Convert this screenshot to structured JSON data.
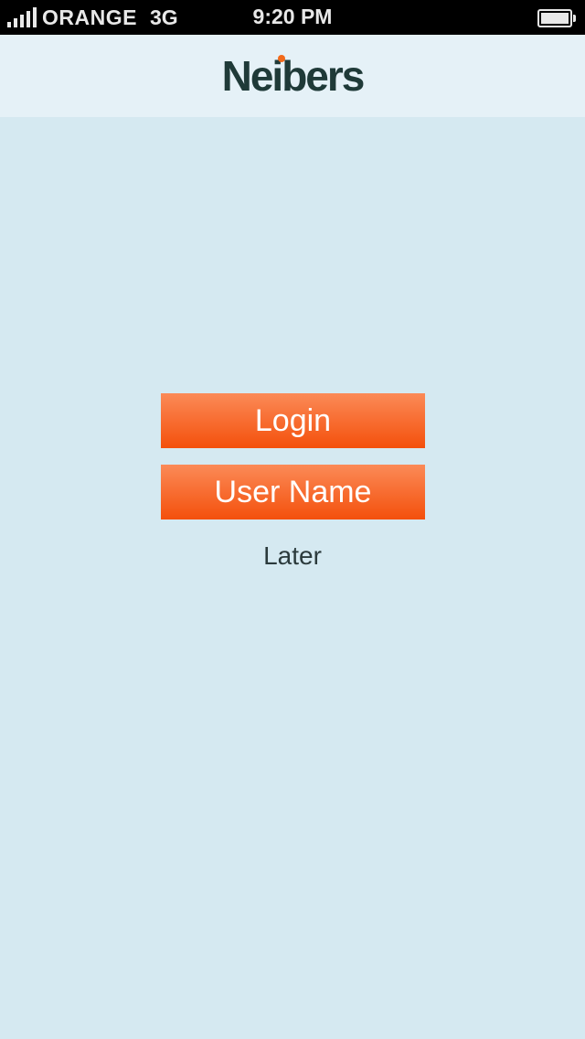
{
  "status_bar": {
    "carrier": "ORANGE",
    "network": "3G",
    "time": "9:20 PM",
    "signal_icon": "signal-bars-icon",
    "battery_icon": "battery-icon"
  },
  "header": {
    "logo_text": "Neibers",
    "logo_dot_color": "#f26a1b"
  },
  "main": {
    "login_label": "Login",
    "username_label": "User Name",
    "later_label": "Later"
  },
  "colors": {
    "background": "#d5e9f1",
    "header_background": "#e5f1f7",
    "button_accent": "#f4500c"
  }
}
